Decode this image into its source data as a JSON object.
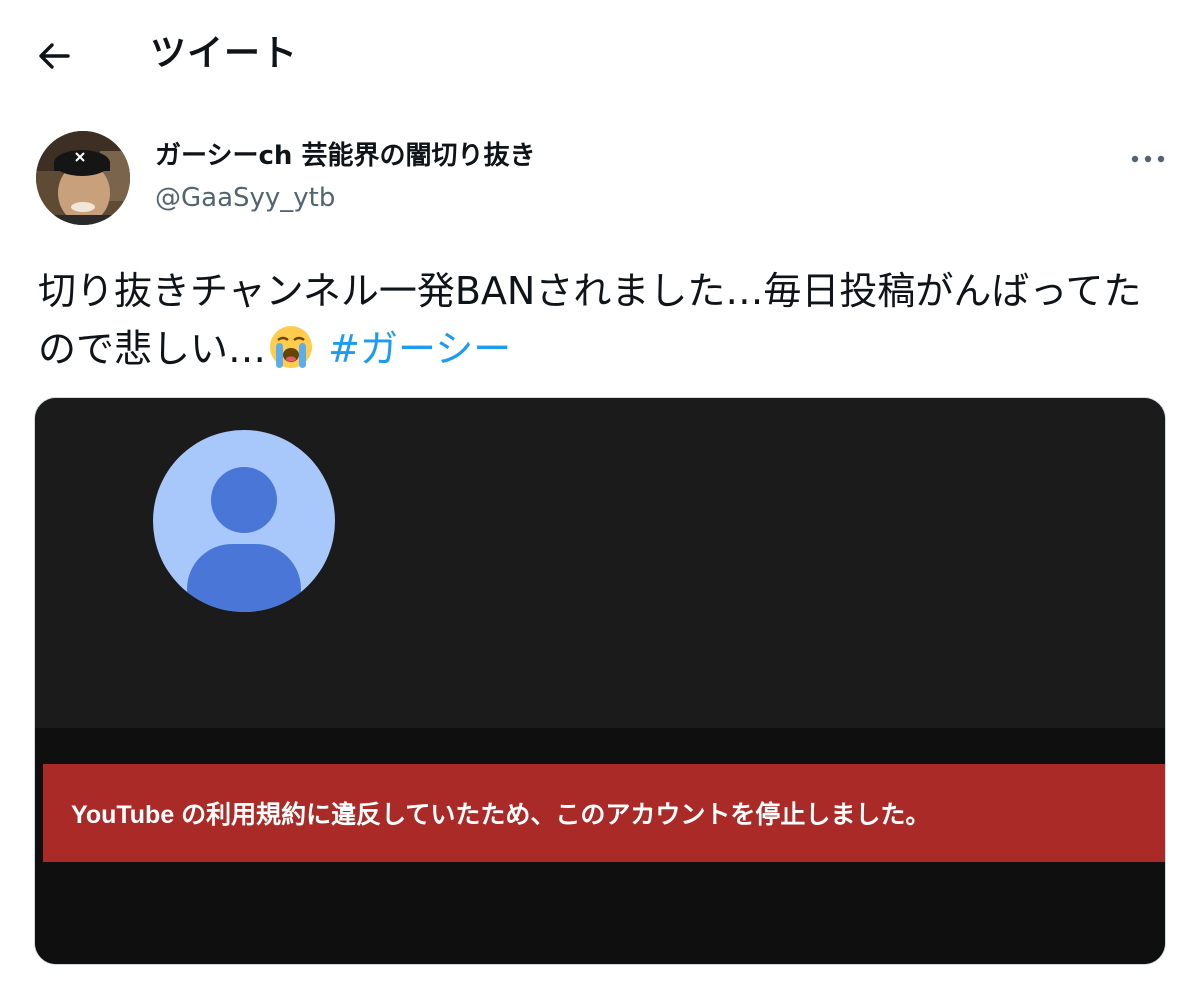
{
  "header": {
    "back_icon": "arrow-left-icon",
    "title": "ツイート"
  },
  "tweet": {
    "author": {
      "display_name": "ガーシーch 芸能界の闇切り抜き",
      "handle": "@GaaSyy_ytb",
      "avatar": "avatar-photo"
    },
    "more_icon": "more-horizontal-icon",
    "text_before_emoji": "切り抜きチャンネル一発BANされました…毎日投稿がんばってたので悲しい…",
    "emoji": "loudly-crying-face-emoji",
    "hashtag": "#ガーシー",
    "media": {
      "placeholder_icon": "default-user-avatar-icon",
      "banner_text": "YouTube の利用規約に違反していたため、このアカウントを停止しました。"
    }
  },
  "colors": {
    "hashtag": "#1d9bf0",
    "handle": "#536471",
    "banner": "#a92a27",
    "avatar_bg": "#a8c7fa",
    "avatar_fg": "#4a76d8"
  }
}
